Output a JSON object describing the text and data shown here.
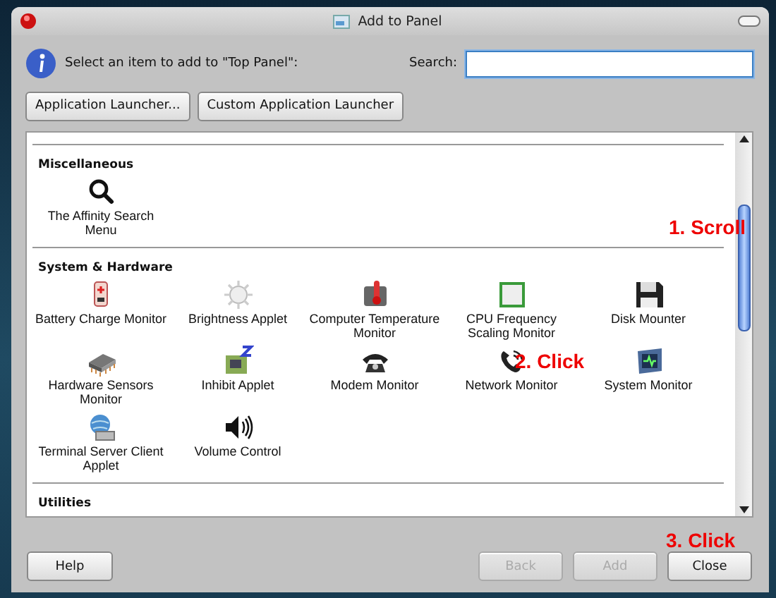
{
  "window": {
    "title": "Add to Panel"
  },
  "prompt": "Select an item to add to \"Top Panel\":",
  "search": {
    "label": "Search:"
  },
  "launcher_buttons": [
    "Application Launcher...",
    "Custom Application Launcher"
  ],
  "sections": [
    {
      "title": "Miscellaneous",
      "items": [
        "The Affinity Search Menu"
      ]
    },
    {
      "title": "System & Hardware",
      "items": [
        "Battery Charge Monitor",
        "Brightness Applet",
        "Computer Temperature Monitor",
        "CPU Frequency Scaling Monitor",
        "Disk Mounter",
        "Hardware Sensors Monitor",
        "Inhibit Applet",
        "Modem Monitor",
        "Network Monitor",
        "System Monitor",
        "Terminal Server Client Applet",
        "Volume Control"
      ]
    },
    {
      "title": "Utilities"
    }
  ],
  "buttons": [
    {
      "label": "Help",
      "disabled": false
    },
    {
      "label": "Back",
      "disabled": true
    },
    {
      "label": "Add",
      "disabled": true
    },
    {
      "label": "Close",
      "disabled": false
    }
  ],
  "annotations": [
    "1. Scroll",
    "2. Click",
    "3. Click"
  ]
}
